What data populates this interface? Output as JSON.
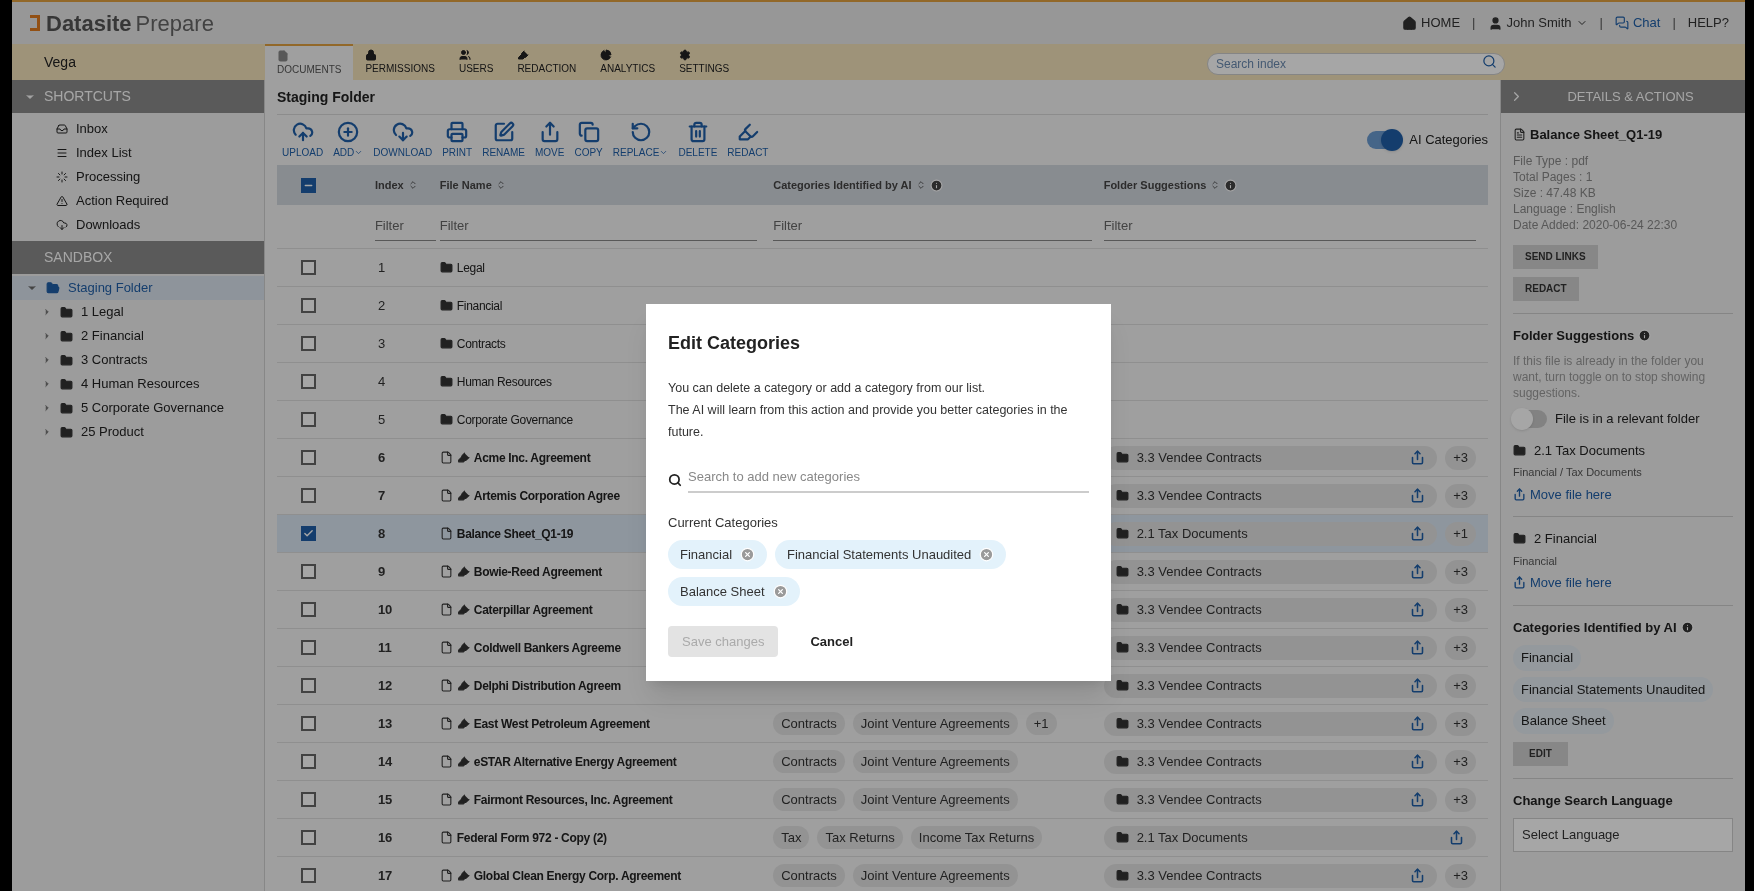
{
  "brand": {
    "name": "Datasite",
    "product": "Prepare"
  },
  "top_nav": [
    {
      "kind": "home",
      "label": "HOME"
    },
    {
      "kind": "user",
      "label": "John Smith",
      "separator": "|"
    },
    {
      "kind": "chat",
      "label": "Chat",
      "separator": "|"
    },
    {
      "kind": "help",
      "label": "HELP?",
      "separator": "|"
    }
  ],
  "workspace": "Vega",
  "tabs": [
    {
      "label": "DOCUMENTS",
      "selected": true
    },
    {
      "label": "PERMISSIONS",
      "selected": false
    },
    {
      "label": "USERS",
      "selected": false
    },
    {
      "label": "REDACTION",
      "selected": false
    },
    {
      "label": "ANALYTICS",
      "selected": false
    },
    {
      "label": "SETTINGS",
      "selected": false
    }
  ],
  "search": {
    "placeholder": "Search index"
  },
  "sidebar": {
    "shortcuts_title": "SHORTCUTS",
    "shortcuts": [
      "Inbox",
      "Index List",
      "Processing",
      "Action Required",
      "Downloads"
    ],
    "sandbox_title": "SANDBOX",
    "tree": {
      "label": "Staging Folder",
      "expanded": true,
      "selected": true,
      "children": [
        {
          "label": "1 Legal",
          "expanded": false
        },
        {
          "label": "2 Financial",
          "expanded": false
        },
        {
          "label": "3 Contracts",
          "expanded": false
        },
        {
          "label": "4 Human Resources",
          "expanded": false
        },
        {
          "label": "5 Corporate Governance",
          "expanded": false
        },
        {
          "label": "25 Product",
          "expanded": false
        }
      ]
    }
  },
  "folder_title": "Staging Folder",
  "toolbar": [
    {
      "label": "UPLOAD",
      "dropdown": false
    },
    {
      "label": "ADD",
      "dropdown": true
    },
    {
      "label": "DOWNLOAD",
      "dropdown": false
    },
    {
      "label": "PRINT",
      "dropdown": false
    },
    {
      "label": "RENAME",
      "dropdown": false
    },
    {
      "label": "MOVE",
      "dropdown": false
    },
    {
      "label": "COPY",
      "dropdown": false
    },
    {
      "label": "REPLACE",
      "dropdown": true
    },
    {
      "label": "DELETE",
      "dropdown": false
    },
    {
      "label": "REDACT",
      "dropdown": false
    }
  ],
  "ai_toggle": {
    "label": "AI Categories",
    "on": true
  },
  "table": {
    "select_all_partial": true,
    "columns": [
      {
        "label": "Index",
        "info": false
      },
      {
        "label": "File Name",
        "info": false
      },
      {
        "label": "Categories Identified by AI",
        "info": true
      },
      {
        "label": "Folder Suggestions",
        "info": true
      }
    ],
    "filters": [
      {
        "placeholder": "Filter"
      },
      {
        "placeholder": "Filter"
      },
      {
        "placeholder": "Filter"
      },
      {
        "placeholder": "Filter"
      }
    ],
    "rows": [
      {
        "index": "1",
        "kind": "folder",
        "name": "Legal",
        "redacted": false,
        "checked": false
      },
      {
        "index": "2",
        "kind": "folder",
        "name": "Financial",
        "redacted": false,
        "checked": false
      },
      {
        "index": "3",
        "kind": "folder",
        "name": "Contracts",
        "redacted": false,
        "checked": false
      },
      {
        "index": "4",
        "kind": "folder",
        "name": "Human Resources",
        "redacted": false,
        "checked": false
      },
      {
        "index": "5",
        "kind": "folder",
        "name": "Corporate Governance",
        "redacted": false,
        "checked": false
      },
      {
        "index": "6",
        "kind": "file",
        "name": "Acme Inc. Agreement",
        "redacted": true,
        "checked": false,
        "folder": "3.3 Vendee Contracts",
        "more": "+3"
      },
      {
        "index": "7",
        "kind": "file",
        "name": "Artemis Corporation Agree",
        "redacted": true,
        "checked": false,
        "folder": "3.3 Vendee Contracts",
        "more": "+3"
      },
      {
        "index": "8",
        "kind": "file",
        "name": "Balance Sheet_Q1-19",
        "redacted": false,
        "checked": true,
        "folder": "2.1 Tax Documents",
        "more": "+1"
      },
      {
        "index": "9",
        "kind": "file",
        "name": "Bowie-Reed Agreement",
        "redacted": true,
        "checked": false,
        "folder": "3.3 Vendee Contracts",
        "more": "+3"
      },
      {
        "index": "10",
        "kind": "file",
        "name": "Caterpillar Agreement",
        "redacted": true,
        "checked": false,
        "folder": "3.3 Vendee Contracts",
        "more": "+3"
      },
      {
        "index": "11",
        "kind": "file",
        "name": "Coldwell Bankers Agreeme",
        "redacted": true,
        "checked": false,
        "folder": "3.3 Vendee Contracts",
        "more": "+3"
      },
      {
        "index": "12",
        "kind": "file",
        "name": "Delphi Distribution Agreem",
        "redacted": true,
        "checked": false,
        "folder": "3.3 Vendee Contracts",
        "more": "+3"
      },
      {
        "index": "13",
        "kind": "file",
        "name": "East West Petroleum Agreement",
        "redacted": true,
        "checked": false,
        "categories": [
          "Contracts",
          "Joint Venture Agreements"
        ],
        "categories_more": "+1",
        "folder": "3.3 Vendee Contracts",
        "more": "+3"
      },
      {
        "index": "14",
        "kind": "file",
        "name": "eSTAR Alternative Energy Agreement",
        "redacted": true,
        "checked": false,
        "categories": [
          "Contracts",
          "Joint Venture Agreements"
        ],
        "folder": "3.3 Vendee Contracts",
        "more": "+3"
      },
      {
        "index": "15",
        "kind": "file",
        "name": "Fairmont Resources, Inc. Agreement",
        "redacted": true,
        "checked": false,
        "categories": [
          "Contracts",
          "Joint Venture Agreements"
        ],
        "folder": "3.3 Vendee Contracts",
        "more": "+3"
      },
      {
        "index": "16",
        "kind": "file",
        "name": "Federal Form 972 - Copy (2)",
        "redacted": false,
        "checked": false,
        "categories": [
          "Tax",
          "Tax Returns",
          "Income Tax Returns"
        ],
        "folder": "2.1 Tax Documents"
      },
      {
        "index": "17",
        "kind": "file",
        "name": "Global Clean Energy Corp. Agreement",
        "redacted": true,
        "checked": false,
        "categories": [
          "Contracts",
          "Joint Venture Agreements"
        ],
        "folder": "3.3 Vendee Contracts",
        "more": "+3"
      }
    ]
  },
  "details": {
    "title": "DETAILS & ACTIONS",
    "file": "Balance Sheet_Q1-19",
    "meta": [
      "File Type : pdf",
      "Total Pages : 1",
      "Size : 47.48 KB",
      "Language : English",
      "Date Added: 2020-06-24 22:30"
    ],
    "buttons": [
      "SEND LINKS",
      "REDACT"
    ],
    "suggestions_title": "Folder Suggestions",
    "suggestions_help": "If this file is already in the folder you want, turn toggle on to stop showing suggestions.",
    "relevant_toggle": {
      "label": "File is in a relevant folder",
      "on": false
    },
    "suggestions": [
      {
        "name": "2.1 Tax Documents",
        "path": "Financial / Tax Documents",
        "action": "Move file here"
      },
      {
        "name": "2 Financial",
        "path": "Financial",
        "action": "Move file here"
      }
    ],
    "categories_title": "Categories Identified by AI",
    "categories": [
      "Financial",
      "Financial Statements Unaudited",
      "Balance Sheet"
    ],
    "edit": "EDIT",
    "language_title": "Change Search Language",
    "language_placeholder": "Select Language"
  },
  "modal": {
    "title": "Edit Categories",
    "lines": [
      "You can delete a category or add a category from our list.",
      "The AI will learn from this action and provide you better categories in the future."
    ],
    "search_placeholder": "Search to add new categories",
    "current_title": "Current Categories",
    "categories": [
      "Financial",
      "Financial Statements Unaudited",
      "Balance Sheet"
    ],
    "save": {
      "label": "Save changes",
      "disabled": true
    },
    "cancel": "Cancel"
  }
}
